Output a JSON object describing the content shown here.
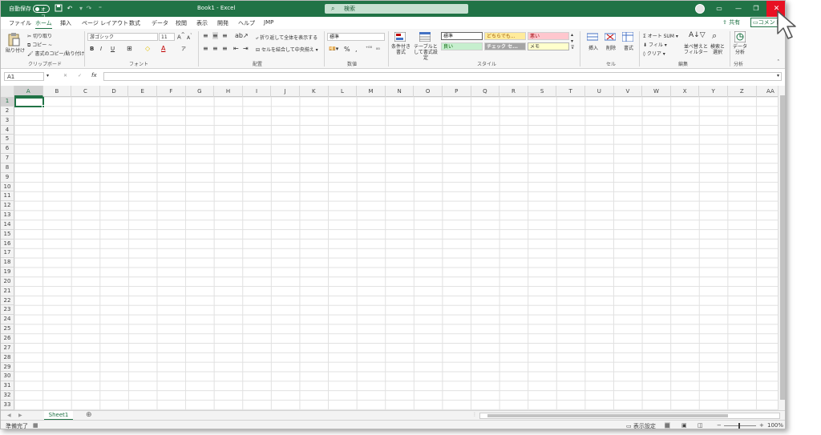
{
  "titlebar": {
    "autosave_label": "自動保存",
    "autosave_state": "オフ",
    "title": "Book1  -  Excel",
    "search_placeholder": "検索",
    "close_glyph": "✕"
  },
  "tabs": [
    "ファイル",
    "ホーム",
    "挿入",
    "ページ レイアウト",
    "数式",
    "データ",
    "校閲",
    "表示",
    "開発",
    "ヘルプ",
    "JMP"
  ],
  "active_tab": "ホーム",
  "share_label": "共有",
  "comment_label": "コメント",
  "ribbon": {
    "clipboard": {
      "paste": "貼り付け",
      "cut": "切り取り",
      "copy": "コピー ~",
      "format_painter": "書式のコピー/貼り付け",
      "label": "クリップボード"
    },
    "font": {
      "font_name": "游ゴシック",
      "font_size": "11",
      "label": "フォント"
    },
    "alignment": {
      "wrap": "折り返して全体を表示する",
      "merge": "セルを結合して中央揃え",
      "label": "配置"
    },
    "number": {
      "format": "標準",
      "label": "数値"
    },
    "styles": {
      "cond_format": "条件付き書式",
      "table_format": "テーブルとして書式設定",
      "cells": [
        "標準",
        "どちらでも...",
        "悪い",
        "良い",
        "チェック セ...",
        "メモ"
      ],
      "label": "スタイル"
    },
    "cells": {
      "insert": "挿入",
      "delete": "削除",
      "format": "書式",
      "label": "セル"
    },
    "editing": {
      "autosum": "オート SUM",
      "fill": "フィル",
      "clear": "クリア",
      "sort": "並べ替えと フィルター",
      "find": "検索と 選択",
      "label": "編集"
    },
    "analysis": {
      "data_analysis": "データ 分析",
      "label": "分析"
    }
  },
  "formula_bar": {
    "name_box": "A1",
    "fx": "fx"
  },
  "columns": [
    "A",
    "B",
    "C",
    "D",
    "E",
    "F",
    "G",
    "H",
    "I",
    "J",
    "K",
    "L",
    "M",
    "N",
    "O",
    "P",
    "Q",
    "R",
    "S",
    "T",
    "U",
    "V",
    "W",
    "X",
    "Y",
    "Z",
    "AA"
  ],
  "rows": [
    "1",
    "2",
    "3",
    "4",
    "5",
    "6",
    "7",
    "8",
    "9",
    "10",
    "11",
    "12",
    "13",
    "14",
    "15",
    "16",
    "17",
    "18",
    "19",
    "20",
    "21",
    "22",
    "23",
    "24",
    "25",
    "26",
    "27",
    "28",
    "29",
    "30",
    "31",
    "32",
    "33"
  ],
  "sheet_tab": "Sheet1",
  "status": {
    "ready": "準備完了",
    "display_settings": "表示設定",
    "zoom": "100%"
  },
  "colors": {
    "accent": "#217346",
    "close": "#e81123"
  }
}
